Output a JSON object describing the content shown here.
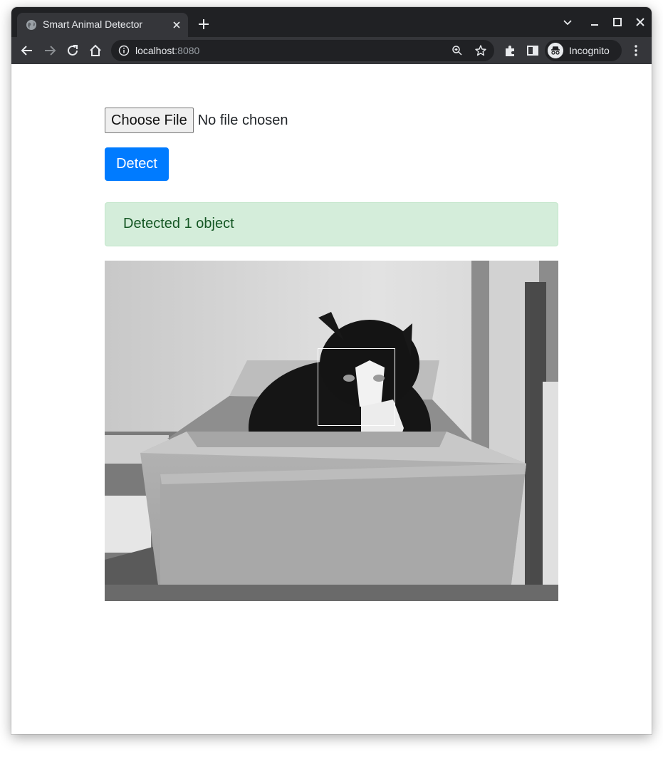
{
  "browser": {
    "tab_title": "Smart Animal Detector",
    "url_host": "localhost",
    "url_port": ":8080",
    "incognito_label": "Incognito",
    "theme_colors": {
      "tabstrip": "#202124",
      "toolbar": "#35363a",
      "text": "#e8eaed"
    }
  },
  "page": {
    "file_input": {
      "button_label": "Choose File",
      "status_text": "No file chosen"
    },
    "detect_button_label": "Detect",
    "alert": {
      "text": "Detected 1 object",
      "color": "#155724",
      "background": "#d4edda"
    },
    "image": {
      "subject": "grayscale photo of a black and white cat sitting in a cardboard box",
      "detections": 1
    },
    "accent_color": "#007bff"
  }
}
